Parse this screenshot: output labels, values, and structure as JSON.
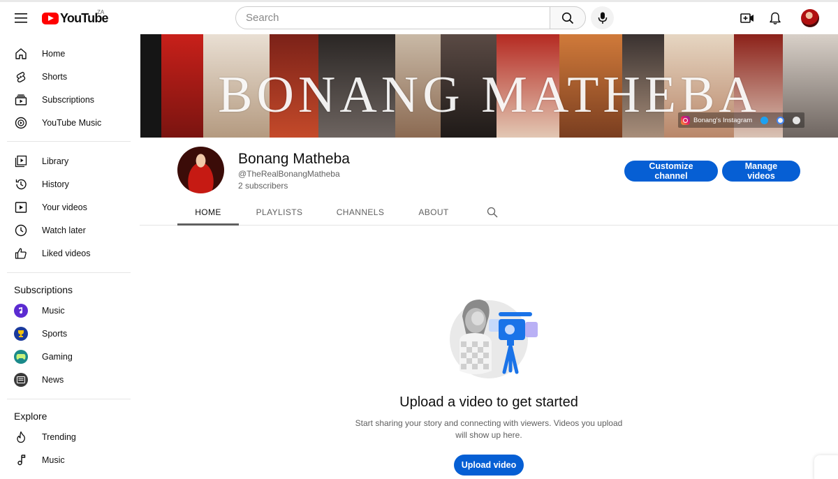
{
  "header": {
    "logo_text": "YouTube",
    "country_code": "ZA",
    "search_placeholder": "Search"
  },
  "sidebar": {
    "main": [
      {
        "label": "Home",
        "icon": "home-icon"
      },
      {
        "label": "Shorts",
        "icon": "shorts-icon"
      },
      {
        "label": "Subscriptions",
        "icon": "subscriptions-icon"
      },
      {
        "label": "YouTube Music",
        "icon": "youtube-music-icon"
      }
    ],
    "library": [
      {
        "label": "Library",
        "icon": "library-icon"
      },
      {
        "label": "History",
        "icon": "history-icon"
      },
      {
        "label": "Your videos",
        "icon": "your-videos-icon"
      },
      {
        "label": "Watch later",
        "icon": "watch-later-icon"
      },
      {
        "label": "Liked videos",
        "icon": "liked-videos-icon"
      }
    ],
    "subscriptions_heading": "Subscriptions",
    "subscriptions": [
      {
        "label": "Music",
        "icon": "music-channel-icon",
        "color": "#5b2bd1"
      },
      {
        "label": "Sports",
        "icon": "sports-channel-icon",
        "color": "#1a3a9c"
      },
      {
        "label": "Gaming",
        "icon": "gaming-channel-icon",
        "color": "#1b8a8a"
      },
      {
        "label": "News",
        "icon": "news-channel-icon",
        "color": "#3a3a3a"
      }
    ],
    "explore_heading": "Explore",
    "explore": [
      {
        "label": "Trending",
        "icon": "trending-icon"
      },
      {
        "label": "Music",
        "icon": "music-note-icon"
      }
    ]
  },
  "banner": {
    "title": "BONANG MATHEBA",
    "instagram_link": "Bonang's Instagram"
  },
  "channel": {
    "name": "Bonang Matheba",
    "handle": "@TheRealBonangMatheba",
    "subscribers": "2 subscribers",
    "customize_label": "Customize channel",
    "manage_label": "Manage videos"
  },
  "tabs": [
    "HOME",
    "PLAYLISTS",
    "CHANNELS",
    "ABOUT"
  ],
  "active_tab": "HOME",
  "empty_state": {
    "title": "Upload a video to get started",
    "description": "Start sharing your story and connecting with viewers. Videos you upload will show up here.",
    "button_label": "Upload video"
  },
  "colors": {
    "accent": "#065fd4",
    "brand_red": "#ff0000"
  }
}
